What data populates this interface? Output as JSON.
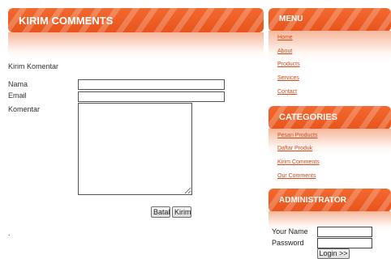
{
  "main": {
    "header_title": "KIRIM COMMENTS",
    "form_title": "Kirim Komentar",
    "fields": {
      "nama_label": "Nama",
      "email_label": "Email",
      "komentar_label": "Komentar",
      "nama_value": "",
      "email_value": "",
      "komentar_value": ""
    },
    "buttons": {
      "batal": "Batal",
      "kirim": "Kirim"
    },
    "footer_dot": "."
  },
  "sidebar": {
    "menu": {
      "title": "MENU",
      "items": [
        "Home",
        "About",
        "Products",
        "Services",
        "Contact"
      ]
    },
    "categories": {
      "title": "CATEGORIES",
      "items": [
        "Pesan Products",
        "Daftar Produk",
        "Kirim Comments",
        "Our Comments"
      ]
    },
    "admin": {
      "title": "ADMINISTRATOR",
      "name_label": "Your Name",
      "password_label": "Password",
      "login_button": "Login >>"
    }
  },
  "colors": {
    "accent": "#e8541c",
    "link": "#d94a1a"
  }
}
